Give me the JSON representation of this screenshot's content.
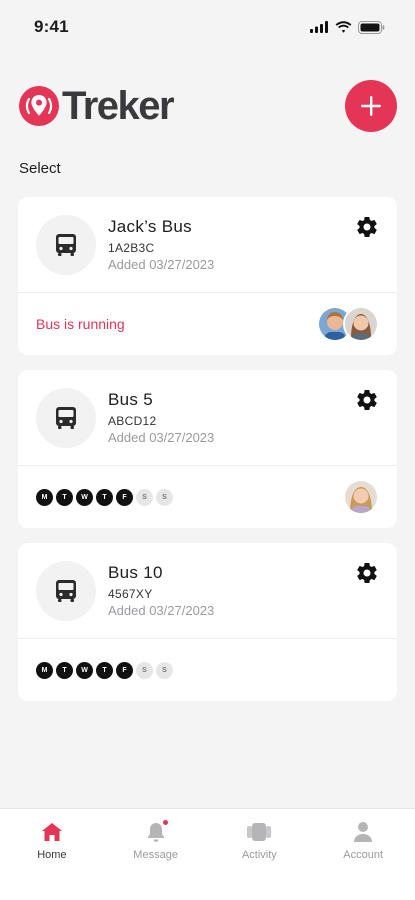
{
  "status_bar": {
    "time": "9:41"
  },
  "header": {
    "brand_name": "Treker"
  },
  "section_label": "Select",
  "buses": [
    {
      "name": "Jack’s Bus",
      "plate": "1A2B3C",
      "added": "Added 03/27/2023",
      "status": "Bus is running",
      "avatars": [
        "boy-avatar",
        "girl-avatar"
      ]
    },
    {
      "name": "Bus 5",
      "plate": "ABCD12",
      "added": "Added 03/27/2023",
      "days": [
        {
          "label": "M",
          "active": true
        },
        {
          "label": "T",
          "active": true
        },
        {
          "label": "W",
          "active": true
        },
        {
          "label": "T",
          "active": true
        },
        {
          "label": "F",
          "active": true
        },
        {
          "label": "S",
          "active": false
        },
        {
          "label": "S",
          "active": false
        }
      ],
      "avatars": [
        "girl-avatar"
      ]
    },
    {
      "name": "Bus 10",
      "plate": "4567XY",
      "added": "Added 03/27/2023",
      "days": [
        {
          "label": "M",
          "active": true
        },
        {
          "label": "T",
          "active": true
        },
        {
          "label": "W",
          "active": true
        },
        {
          "label": "T",
          "active": true
        },
        {
          "label": "F",
          "active": true
        },
        {
          "label": "S",
          "active": false
        },
        {
          "label": "S",
          "active": false
        }
      ]
    }
  ],
  "bottom_nav": {
    "items": [
      {
        "label": "Home",
        "icon": "home-icon",
        "active": true
      },
      {
        "label": "Message",
        "icon": "bell-icon",
        "active": false
      },
      {
        "label": "Activity",
        "icon": "activity-icon",
        "active": false
      },
      {
        "label": "Account",
        "icon": "person-icon",
        "active": false
      }
    ]
  },
  "colors": {
    "accent": "#e43557",
    "background": "#f4f4f4",
    "card": "#ffffff",
    "day_active": "#111111",
    "day_inactive": "#e6e6e6"
  }
}
